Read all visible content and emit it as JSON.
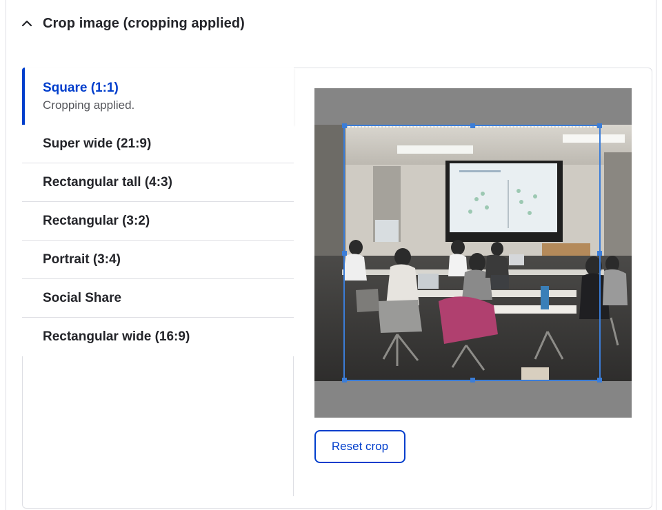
{
  "details": {
    "title": "Crop image (cropping applied)",
    "expanded": true,
    "icon": "chevron-up-icon"
  },
  "tabs": [
    {
      "label": "Square (1:1)",
      "status": "Cropping applied.",
      "active": true
    },
    {
      "label": "Super wide (21:9)"
    },
    {
      "label": "Rectangular tall (4:3)"
    },
    {
      "label": "Rectangular (3:2)"
    },
    {
      "label": "Portrait (3:4)"
    },
    {
      "label": "Social Share"
    },
    {
      "label": "Rectangular wide (16:9)"
    }
  ],
  "cropper": {
    "image_subject": "classroom with students at laptops facing a projection screen",
    "aspect_ratio": "1:1"
  },
  "actions": {
    "reset_label": "Reset crop"
  },
  "colors": {
    "accent": "#003ecc",
    "crop_border": "#3b7dd8",
    "crop_background": "#858585"
  }
}
